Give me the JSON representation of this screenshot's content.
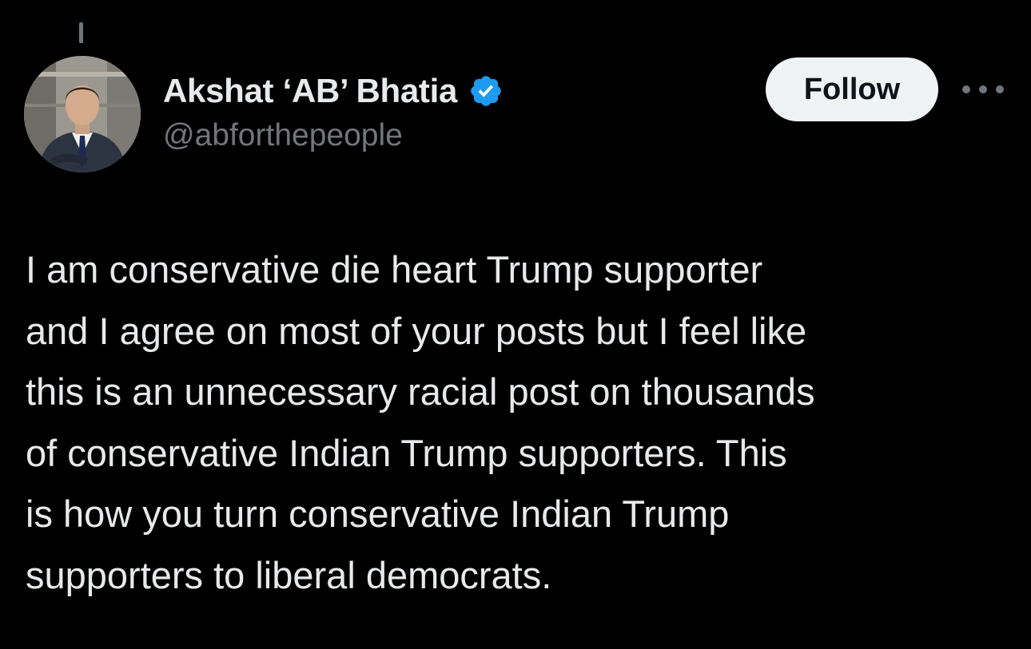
{
  "post": {
    "author": {
      "display_name": "Akshat ‘AB’ Bhatia",
      "handle": "@abforthepeople",
      "verified": true,
      "avatar_icon": "profile-photo"
    },
    "follow_label": "Follow",
    "more_icon": "more-options-icon",
    "text_lines": [
      "I am conservative die heart Trump supporter",
      "and I agree on most of your posts but I feel like",
      "this is an unnecessary racial post on thousands",
      "of conservative Indian Trump supporters. This",
      "is how you turn conservative Indian Trump",
      "supporters to liberal democrats."
    ]
  },
  "colors": {
    "background": "#000000",
    "primary_text": "#e7e9ea",
    "secondary_text": "#71767b",
    "verified_badge": "#1d9bf0",
    "follow_button_bg": "#eff3f4",
    "follow_button_text": "#0f1419"
  }
}
